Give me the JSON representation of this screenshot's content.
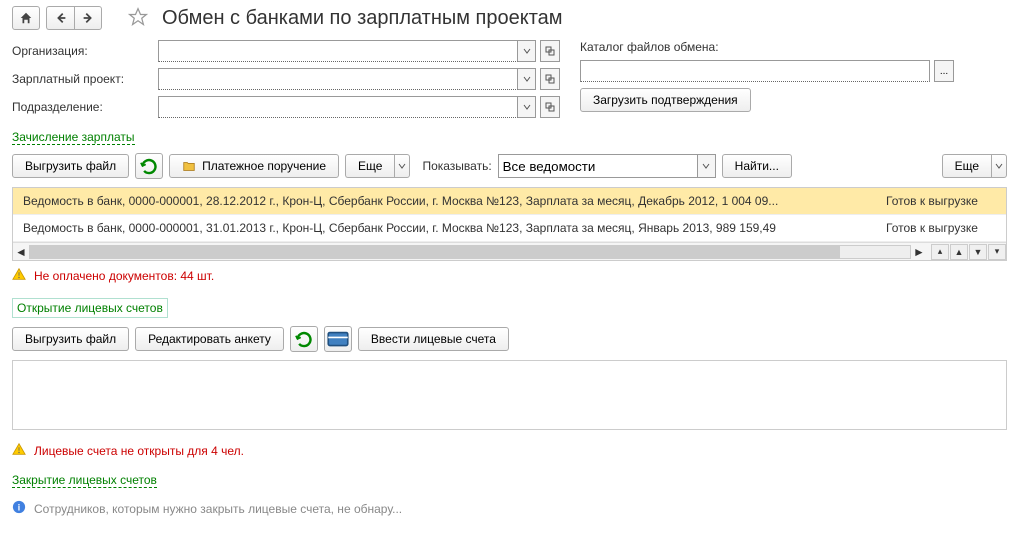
{
  "header": {
    "title": "Обмен с банками по зарплатным проектам"
  },
  "form": {
    "org_label": "Организация:",
    "org_value": "",
    "project_label": "Зарплатный проект:",
    "project_value": "",
    "dept_label": "Подразделение:",
    "dept_value": "",
    "catalog_label": "Каталог файлов обмена:",
    "catalog_value": "",
    "load_confirm": "Загрузить подтверждения"
  },
  "section1": {
    "link": "Зачисление зарплаты",
    "export_btn": "Выгрузить файл",
    "payment_btn": "Платежное поручение",
    "more_btn": "Еще",
    "show_label": "Показывать:",
    "show_value": "Все ведомости",
    "find_btn": "Найти...",
    "more_btn2": "Еще",
    "rows": [
      {
        "desc": "Ведомость в банк, 0000-000001, 28.12.2012 г., Крон-Ц, Сбербанк России, г. Москва №123, Зарплата за месяц, Декабрь 2012, 1 004 09...",
        "status": "Готов к выгрузке"
      },
      {
        "desc": "Ведомость в банк, 0000-000001, 31.01.2013 г., Крон-Ц, Сбербанк России, г. Москва №123, Зарплата за месяц, Январь 2013, 989 159,49",
        "status": "Готов к выгрузке"
      }
    ],
    "warning": "Не оплачено документов: 44 шт."
  },
  "section2": {
    "link": "Открытие лицевых счетов",
    "export_btn": "Выгрузить файл",
    "edit_btn": "Редактировать анкету",
    "enter_btn": "Ввести лицевые счета",
    "warning": "Лицевые счета не открыты для 4 чел."
  },
  "section3": {
    "link": "Закрытие лицевых счетов",
    "info": "Сотрудников, которым нужно закрыть лицевые счета, не обнару..."
  }
}
